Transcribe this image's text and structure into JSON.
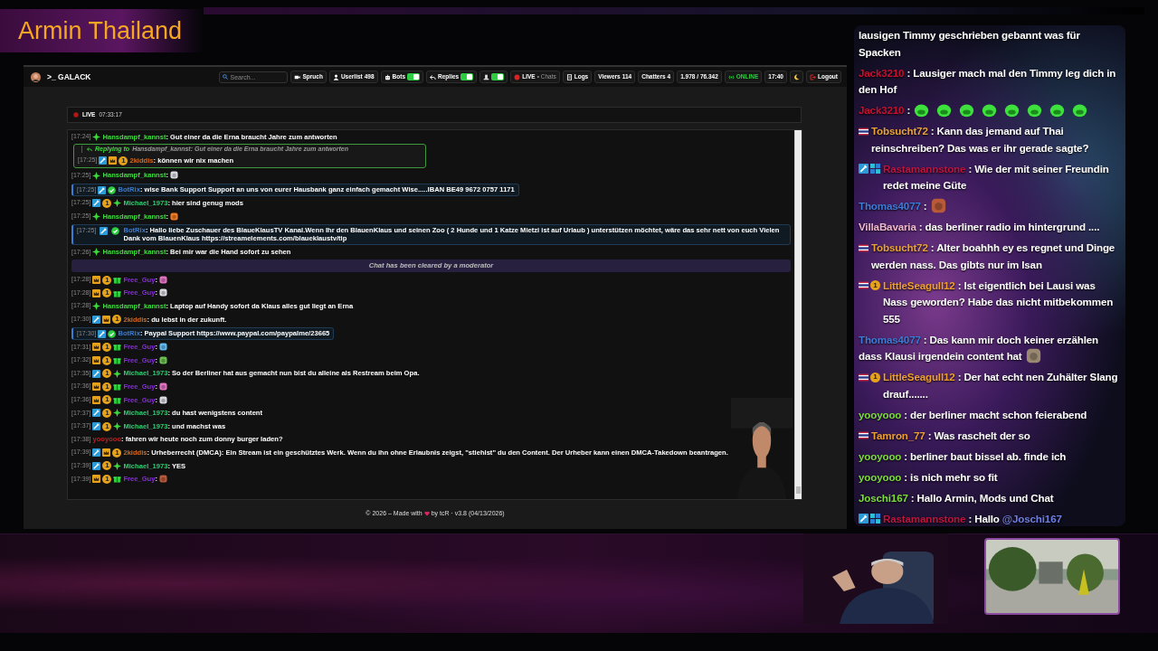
{
  "overlay_title": "Armin Thailand",
  "app": {
    "navbar": {
      "brand": ">_ GALACK",
      "search": {
        "placeholder": "Search..."
      },
      "items": [
        {
          "kind": "button",
          "label": "Spruch"
        },
        {
          "kind": "counter",
          "label": "Userlist",
          "count": "498"
        },
        {
          "kind": "toggle",
          "label": "Bots",
          "on": true
        },
        {
          "kind": "toggle",
          "label": "Replies",
          "on": true
        },
        {
          "kind": "toggle",
          "on": true
        },
        {
          "kind": "live",
          "label": "LIVE",
          "detail": "• Chats"
        },
        {
          "kind": "button",
          "label": "Logs"
        },
        {
          "kind": "counter",
          "label": "Viewers",
          "count": "114"
        },
        {
          "kind": "counter",
          "label": "Chatters",
          "count": "4"
        },
        {
          "kind": "counter",
          "count": "1.978 / 76.342"
        },
        {
          "kind": "status",
          "label": "ONLINE"
        },
        {
          "kind": "counter",
          "count": "17:40"
        },
        {
          "kind": "icon"
        },
        {
          "kind": "logout",
          "label": "Logout"
        }
      ]
    },
    "live_bar": {
      "label": "LIVE",
      "time": "07:33:17"
    },
    "messages": [
      {
        "kind": "normal",
        "time": "[17:24]",
        "badges": [
          {
            "kind": "plus"
          }
        ],
        "user": "Hansdampf_kannst",
        "color": "#3ddc3d",
        "text": ": Gut einer da die Erna braucht Jahre zum antworten"
      },
      {
        "kind": "reply",
        "reply_label": "Replying to",
        "reply_text": "Hansdampf_kannst: Gut einer da die Erna braucht Jahre zum antworten",
        "time": "[17:25]",
        "badges": [
          {
            "kind": "mod"
          },
          {
            "kind": "crown"
          },
          {
            "kind": "coin",
            "label": "1"
          }
        ],
        "user": "2kiddis",
        "color": "#d2691e",
        "text": ": können wir nix machen"
      },
      {
        "kind": "normal",
        "time": "[17:25]",
        "badges": [
          {
            "kind": "plus"
          }
        ],
        "user": "Hansdampf_kannst",
        "color": "#3ddc3d",
        "text": ":",
        "emotes": [
          {
            "kind": "emote"
          }
        ]
      },
      {
        "kind": "bot",
        "time": "[17:25]",
        "badges": [
          {
            "kind": "mod"
          },
          {
            "kind": "verified"
          }
        ],
        "user": "BotRix",
        "color": "#3a7bd5",
        "text": ": wise Bank Support Support an uns von eurer Hausbank ganz einfach gemacht Wise.....IBAN BE49 9672 0757 1171"
      },
      {
        "kind": "normal",
        "time": "[17:25]",
        "badges": [
          {
            "kind": "mod"
          },
          {
            "kind": "coin",
            "label": "1"
          },
          {
            "kind": "plus"
          }
        ],
        "user": "Michael_1973",
        "color": "#2ecc71",
        "text": ": hier sind genug mods"
      },
      {
        "kind": "normal",
        "time": "[17:25]",
        "badges": [
          {
            "kind": "plus"
          }
        ],
        "user": "Hansdampf_kannst",
        "color": "#3ddc3d",
        "text": ":",
        "emotes": [
          {
            "kind": "emote"
          }
        ]
      },
      {
        "kind": "bot",
        "time": "[17:25]",
        "badges": [
          {
            "kind": "mod"
          },
          {
            "kind": "verified"
          }
        ],
        "user": "BotRix",
        "color": "#3a7bd5",
        "text": ": Hallo liebe Zuschauer des BlaueKlausTV Kanal.Wenn Ihr den BlauenKlaus und seinen Zoo ( 2 Hunde und 1 Katze Mietzi ist auf Urlaub ) unterstützen möchtet, wäre das sehr nett von euch Vielen Dank vom BlauenKlaus https://streamelements.com/blaueklaustv/tip"
      },
      {
        "kind": "normal",
        "time": "[17:26]",
        "badges": [
          {
            "kind": "plus"
          }
        ],
        "user": "Hansdampf_kannst",
        "color": "#3ddc3d",
        "text": ": Bei mir war die Hand sofort zu sehen"
      },
      {
        "kind": "notice",
        "text": "Chat has been cleared by a moderator"
      },
      {
        "kind": "normal",
        "time": "[17:28]",
        "badges": [
          {
            "kind": "crown"
          },
          {
            "kind": "coin",
            "label": "1"
          },
          {
            "kind": "gift"
          }
        ],
        "user": "Free_Guy",
        "color": "#8a2be2",
        "text": ":",
        "emotes": [
          {
            "kind": "emote"
          }
        ]
      },
      {
        "kind": "normal",
        "time": "[17:28]",
        "badges": [
          {
            "kind": "crown"
          },
          {
            "kind": "coin",
            "label": "1"
          },
          {
            "kind": "gift"
          }
        ],
        "user": "Free_Guy",
        "color": "#8a2be2",
        "text": ":",
        "emotes": [
          {
            "kind": "emote"
          }
        ]
      },
      {
        "kind": "normal",
        "time": "[17:28]",
        "badges": [
          {
            "kind": "plus"
          }
        ],
        "user": "Hansdampf_kannst",
        "color": "#3ddc3d",
        "text": ": Laptop auf Handy sofort da Klaus alles gut liegt an Erna"
      },
      {
        "kind": "normal",
        "time": "[17:30]",
        "badges": [
          {
            "kind": "mod"
          },
          {
            "kind": "crown"
          },
          {
            "kind": "coin",
            "label": "1"
          }
        ],
        "user": "2kiddis",
        "color": "#d2691e",
        "text": ": du lebst in der zukunft."
      },
      {
        "kind": "bot",
        "time": "[17:30]",
        "badges": [
          {
            "kind": "mod"
          },
          {
            "kind": "verified"
          }
        ],
        "user": "BotRix",
        "color": "#3a7bd5",
        "text": ": Paypal Support https://www.paypal.com/paypalme/23665"
      },
      {
        "kind": "normal",
        "time": "[17:31]",
        "badges": [
          {
            "kind": "crown"
          },
          {
            "kind": "coin",
            "label": "1"
          },
          {
            "kind": "gift"
          }
        ],
        "user": "Free_Guy",
        "color": "#8a2be2",
        "text": ":",
        "emotes": [
          {
            "kind": "emote"
          }
        ]
      },
      {
        "kind": "normal",
        "time": "[17:32]",
        "badges": [
          {
            "kind": "crown"
          },
          {
            "kind": "coin",
            "label": "1"
          },
          {
            "kind": "gift"
          }
        ],
        "user": "Free_Guy",
        "color": "#8a2be2",
        "text": ":",
        "emotes": [
          {
            "kind": "emote"
          }
        ]
      },
      {
        "kind": "normal",
        "time": "[17:35]",
        "badges": [
          {
            "kind": "mod"
          },
          {
            "kind": "coin",
            "label": "1"
          },
          {
            "kind": "plus"
          }
        ],
        "user": "Michael_1973",
        "color": "#2ecc71",
        "text": ": So der Berliner hat aus gemacht nun bist du alleine als Restream beim Opa."
      },
      {
        "kind": "normal",
        "time": "[17:36]",
        "badges": [
          {
            "kind": "crown"
          },
          {
            "kind": "coin",
            "label": "1"
          },
          {
            "kind": "gift"
          }
        ],
        "user": "Free_Guy",
        "color": "#8a2be2",
        "text": ":",
        "emotes": [
          {
            "kind": "emote"
          }
        ]
      },
      {
        "kind": "normal",
        "time": "[17:36]",
        "badges": [
          {
            "kind": "crown"
          },
          {
            "kind": "coin",
            "label": "1"
          },
          {
            "kind": "gift"
          }
        ],
        "user": "Free_Guy",
        "color": "#8a2be2",
        "text": ":",
        "emotes": [
          {
            "kind": "emote"
          }
        ]
      },
      {
        "kind": "normal",
        "time": "[17:37]",
        "badges": [
          {
            "kind": "mod"
          },
          {
            "kind": "coin",
            "label": "1"
          },
          {
            "kind": "plus"
          }
        ],
        "user": "Michael_1973",
        "color": "#2ecc71",
        "text": ": du hast wenigstens content"
      },
      {
        "kind": "normal",
        "time": "[17:37]",
        "badges": [
          {
            "kind": "mod"
          },
          {
            "kind": "coin",
            "label": "1"
          },
          {
            "kind": "plus"
          }
        ],
        "user": "Michael_1973",
        "color": "#2ecc71",
        "text": ": und machst was"
      },
      {
        "kind": "normal",
        "time": "[17:38]",
        "user": "yooyooo",
        "color": "#b22222",
        "text": ": fahren wir heute noch zum donny burger laden?"
      },
      {
        "kind": "normal",
        "time": "[17:39]",
        "badges": [
          {
            "kind": "mod"
          },
          {
            "kind": "crown"
          },
          {
            "kind": "coin",
            "label": "1"
          }
        ],
        "user": "2kiddis",
        "color": "#d2691e",
        "text": ": Urheberrecht (DMCA): Ein Stream ist ein geschütztes Werk. Wenn du ihn ohne Erlaubnis zeigst, \"stiehlst\" du den Content. Der Urheber kann einen DMCA-Takedown beantragen."
      },
      {
        "kind": "normal",
        "time": "[17:39]",
        "badges": [
          {
            "kind": "mod"
          },
          {
            "kind": "coin",
            "label": "1"
          },
          {
            "kind": "plus"
          }
        ],
        "user": "Michael_1973",
        "color": "#2ecc71",
        "text": ": YES"
      },
      {
        "kind": "normal",
        "time": "[17:39]",
        "badges": [
          {
            "kind": "crown"
          },
          {
            "kind": "coin",
            "label": "1"
          },
          {
            "kind": "gift"
          }
        ],
        "user": "Free_Guy",
        "color": "#8a2be2",
        "text": ":",
        "emotes": [
          {
            "kind": "emote"
          }
        ]
      }
    ],
    "footer": {
      "before": "© 2026 – Made with",
      "after": "by tcR · v3.8 (04/13/2026)"
    }
  },
  "stream_chat": [
    {
      "text": "lausigen Timmy geschrieben gebannt was für Spacken"
    },
    {
      "user": "Jack3210",
      "color": "#c8102e",
      "text": ": Lausiger mach mal den Timmy leg dich in den Hof"
    },
    {
      "user": "Jack3210",
      "color": "#c8102e",
      "text": ":",
      "emotes": [
        {
          "kind": "emote"
        },
        {
          "kind": "emote"
        },
        {
          "kind": "emote"
        },
        {
          "kind": "emote"
        },
        {
          "kind": "emote"
        },
        {
          "kind": "emote"
        },
        {
          "kind": "emote"
        },
        {
          "kind": "emote"
        }
      ]
    },
    {
      "badges": [
        {
          "kind": "flag"
        }
      ],
      "user": "Tobsucht72",
      "color": "#e8a33d",
      "text": ": Kann das jemand auf Thai reinschreiben? Das was er ihr gerade sagte?"
    },
    {
      "badges": [
        {
          "kind": "mod"
        },
        {
          "kind": "sub"
        }
      ],
      "user": "Rastamannstone",
      "color": "#c0143c",
      "text": ": Wie der mit seiner Freundin redet meine Güte"
    },
    {
      "user": "Thomas4077",
      "color": "#3b7dd8",
      "text": ":",
      "emotes": [
        {
          "kind": "emote"
        }
      ]
    },
    {
      "user": "VillaBavaria",
      "color": "#f0b8cc",
      "text": ": das berliner radio im hintergrund ...."
    },
    {
      "badges": [
        {
          "kind": "flag"
        }
      ],
      "user": "Tobsucht72",
      "color": "#e8a33d",
      "text": ": Alter boahhh ey es regnet und Dinge werden nass. Das gibts nur im Isan"
    },
    {
      "badges": [
        {
          "kind": "flag"
        },
        {
          "kind": "coin",
          "label": "1"
        }
      ],
      "user": "LittleSeagull12",
      "color": "#f0a030",
      "text": ": Ist eigentlich bei Lausi was Nass geworden? Habe das nicht mitbekommen 555"
    },
    {
      "user": "Thomas4077",
      "color": "#3b7dd8",
      "text": ": Das kann mir doch keiner erzählen dass Klausi irgendein content hat",
      "emotes": [
        {
          "kind": "emote"
        }
      ]
    },
    {
      "badges": [
        {
          "kind": "flag"
        },
        {
          "kind": "coin",
          "label": "1"
        }
      ],
      "user": "LittleSeagull12",
      "color": "#f0a030",
      "text": ": Der hat echt nen Zuhälter Slang drauf......."
    },
    {
      "user": "yooyooo",
      "color": "#7cdc3c",
      "text": ": der berliner macht schon feierabend"
    },
    {
      "badges": [
        {
          "kind": "flag"
        }
      ],
      "user": "Tamron_77",
      "color": "#f0a030",
      "text": ": Was raschelt der so"
    },
    {
      "user": "yooyooo",
      "color": "#7cdc3c",
      "text": ": berliner baut bissel ab. finde ich"
    },
    {
      "user": "yooyooo",
      "color": "#7cdc3c",
      "text": ": is nich mehr so fit"
    },
    {
      "user": "Joschi167",
      "color": "#7cdc3c",
      "text": ": Hallo Armin, Mods und Chat"
    },
    {
      "badges": [
        {
          "kind": "mod"
        },
        {
          "kind": "sub"
        }
      ],
      "user": "Rastamannstone",
      "color": "#c0143c",
      "text": ": Hallo",
      "mention": "@Joschi167"
    }
  ]
}
